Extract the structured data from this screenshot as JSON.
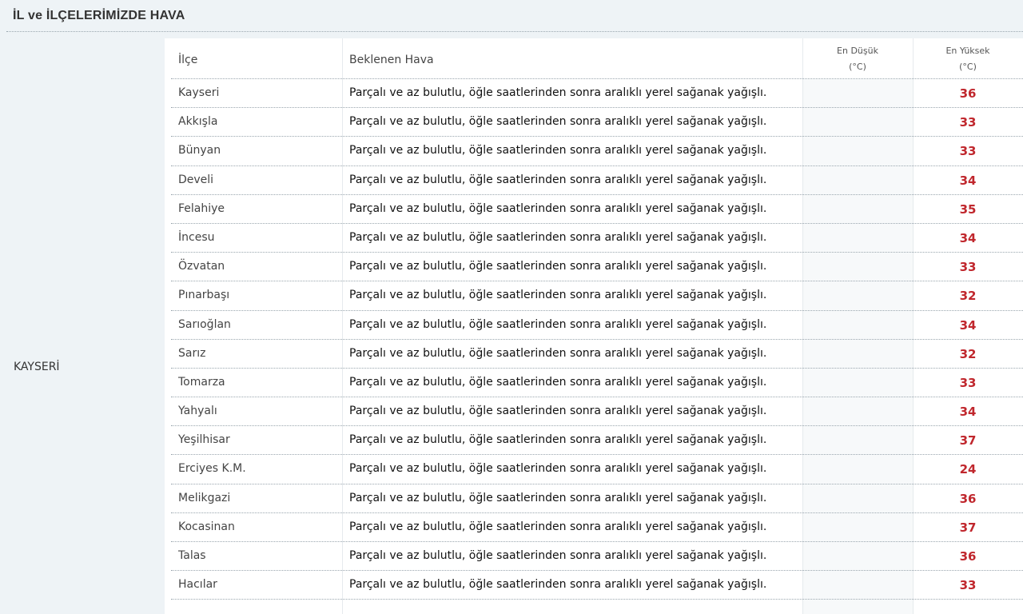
{
  "header": {
    "title": "İL ve İLÇELERİMİZDE HAVA"
  },
  "province": "KAYSERİ",
  "table": {
    "columns": {
      "ilce": "İlçe",
      "hava": "Beklenen Hava",
      "min_line1": "En Düşük",
      "min_line2": "(°C)",
      "max_line1": "En Yüksek",
      "max_line2": "(°C)"
    },
    "rows": [
      {
        "ilce": "Kayseri",
        "hava": "Parçalı ve az bulutlu, öğle saatlerinden sonra aralıklı yerel sağanak yağışlı.",
        "min": "",
        "max": "36"
      },
      {
        "ilce": "Akkışla",
        "hava": "Parçalı ve az bulutlu, öğle saatlerinden sonra aralıklı yerel sağanak yağışlı.",
        "min": "",
        "max": "33"
      },
      {
        "ilce": "Bünyan",
        "hava": "Parçalı ve az bulutlu, öğle saatlerinden sonra aralıklı yerel sağanak yağışlı.",
        "min": "",
        "max": "33"
      },
      {
        "ilce": "Develi",
        "hava": "Parçalı ve az bulutlu, öğle saatlerinden sonra aralıklı yerel sağanak yağışlı.",
        "min": "",
        "max": "34"
      },
      {
        "ilce": "Felahiye",
        "hava": "Parçalı ve az bulutlu, öğle saatlerinden sonra aralıklı yerel sağanak yağışlı.",
        "min": "",
        "max": "35"
      },
      {
        "ilce": "İncesu",
        "hava": "Parçalı ve az bulutlu, öğle saatlerinden sonra aralıklı yerel sağanak yağışlı.",
        "min": "",
        "max": "34"
      },
      {
        "ilce": "Özvatan",
        "hava": "Parçalı ve az bulutlu, öğle saatlerinden sonra aralıklı yerel sağanak yağışlı.",
        "min": "",
        "max": "33"
      },
      {
        "ilce": "Pınarbaşı",
        "hava": "Parçalı ve az bulutlu, öğle saatlerinden sonra aralıklı yerel sağanak yağışlı.",
        "min": "",
        "max": "32"
      },
      {
        "ilce": "Sarıoğlan",
        "hava": "Parçalı ve az bulutlu, öğle saatlerinden sonra aralıklı yerel sağanak yağışlı.",
        "min": "",
        "max": "34"
      },
      {
        "ilce": "Sarız",
        "hava": "Parçalı ve az bulutlu, öğle saatlerinden sonra aralıklı yerel sağanak yağışlı.",
        "min": "",
        "max": "32"
      },
      {
        "ilce": "Tomarza",
        "hava": "Parçalı ve az bulutlu, öğle saatlerinden sonra aralıklı yerel sağanak yağışlı.",
        "min": "",
        "max": "33"
      },
      {
        "ilce": "Yahyalı",
        "hava": "Parçalı ve az bulutlu, öğle saatlerinden sonra aralıklı yerel sağanak yağışlı.",
        "min": "",
        "max": "34"
      },
      {
        "ilce": "Yeşilhisar",
        "hava": "Parçalı ve az bulutlu, öğle saatlerinden sonra aralıklı yerel sağanak yağışlı.",
        "min": "",
        "max": "37"
      },
      {
        "ilce": "Erciyes K.M.",
        "hava": "Parçalı ve az bulutlu, öğle saatlerinden sonra aralıklı yerel sağanak yağışlı.",
        "min": "",
        "max": "24"
      },
      {
        "ilce": "Melikgazi",
        "hava": "Parçalı ve az bulutlu, öğle saatlerinden sonra aralıklı yerel sağanak yağışlı.",
        "min": "",
        "max": "36"
      },
      {
        "ilce": "Kocasinan",
        "hava": "Parçalı ve az bulutlu, öğle saatlerinden sonra aralıklı yerel sağanak yağışlı.",
        "min": "",
        "max": "37"
      },
      {
        "ilce": "Talas",
        "hava": "Parçalı ve az bulutlu, öğle saatlerinden sonra aralıklı yerel sağanak yağışlı.",
        "min": "",
        "max": "36"
      },
      {
        "ilce": "Hacılar",
        "hava": "Parçalı ve az bulutlu, öğle saatlerinden sonra aralıklı yerel sağanak yağışlı.",
        "min": "",
        "max": "33"
      }
    ]
  },
  "colors": {
    "background": "#eef3f6",
    "max_temp": "#c0272d",
    "row_border": "#9aa6ae"
  }
}
